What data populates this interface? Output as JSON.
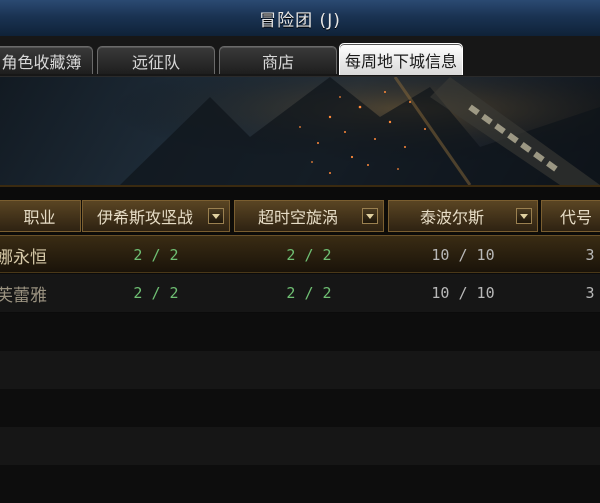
{
  "window": {
    "title": "冒险团 (J)"
  },
  "tabs": [
    {
      "label": "角色收藏簿",
      "active": false
    },
    {
      "label": "远征队",
      "active": false
    },
    {
      "label": "商店",
      "active": false
    },
    {
      "label": "每周地下城信息",
      "active": true
    }
  ],
  "table": {
    "headers": [
      "职业",
      "伊希斯攻坚战",
      "超时空旋涡",
      "泰波尔斯",
      "代号"
    ],
    "rows": [
      {
        "name": "娜永恒",
        "c1": "2 / 2",
        "c2": "2 / 2",
        "c3": "10 / 10",
        "c4": "3",
        "selected": true
      },
      {
        "name": "芙蕾雅",
        "c1": "2 / 2",
        "c2": "2 / 2",
        "c3": "10 / 10",
        "c4": "3",
        "selected": false
      }
    ]
  },
  "colors": {
    "accent": "#2b4a72",
    "header_gold": "#5a4523",
    "completed_green": "#6fbf73"
  }
}
